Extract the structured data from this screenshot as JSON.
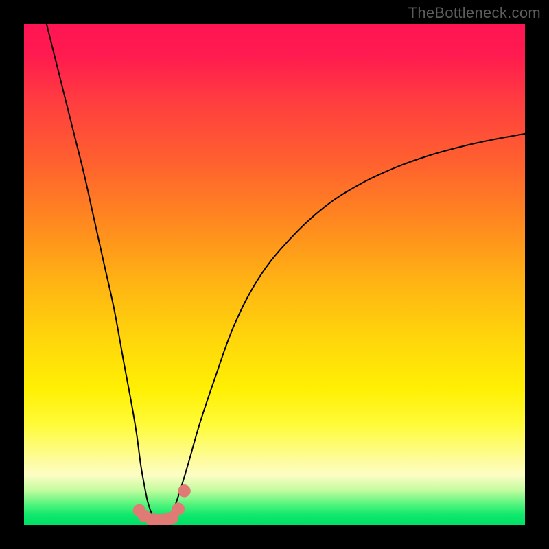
{
  "watermark": "TheBottleneck.com",
  "chart_data": {
    "type": "line",
    "title": "",
    "xlabel": "",
    "ylabel": "",
    "x_range": [
      0,
      100
    ],
    "y_range": [
      0,
      100
    ],
    "series": [
      {
        "name": "left-curve",
        "x": [
          4.5,
          6,
          8,
          10,
          12,
          14,
          16,
          18,
          20,
          21.5,
          22.5,
          23.3,
          24,
          24.6,
          25.2,
          25.8,
          26.4,
          27.0,
          27.5
        ],
        "y": [
          100,
          94,
          86,
          78,
          70,
          61,
          52,
          43,
          32,
          24,
          18,
          12,
          8,
          5,
          3,
          1.7,
          0.8,
          0.3,
          0.0
        ]
      },
      {
        "name": "right-curve",
        "x": [
          27.5,
          28.2,
          29.0,
          30.0,
          31.2,
          33.0,
          35.0,
          38.0,
          42.0,
          47.0,
          53.0,
          60.0,
          67.0,
          74.0,
          81.0,
          88.0,
          94.0,
          100.0
        ],
        "y": [
          0.0,
          0.5,
          1.5,
          3.5,
          7.0,
          13.0,
          20.0,
          29.0,
          40.0,
          49.5,
          57.0,
          63.5,
          68.0,
          71.3,
          73.8,
          75.7,
          77.0,
          78.1
        ]
      }
    ],
    "markers": [
      {
        "name": "valley",
        "x": 23.0,
        "y": 2.9,
        "r": 1.0
      },
      {
        "name": "valley",
        "x": 24.0,
        "y": 1.8,
        "r": 1.0
      },
      {
        "name": "valley",
        "x": 25.8,
        "y": 0.9,
        "r": 1.2
      },
      {
        "name": "valley",
        "x": 27.0,
        "y": 0.8,
        "r": 1.2
      },
      {
        "name": "valley",
        "x": 28.2,
        "y": 0.9,
        "r": 1.2
      },
      {
        "name": "valley",
        "x": 29.6,
        "y": 1.5,
        "r": 1.0
      },
      {
        "name": "valley",
        "x": 30.8,
        "y": 3.2,
        "r": 1.0
      },
      {
        "name": "valley",
        "x": 32.0,
        "y": 6.8,
        "r": 1.0
      }
    ],
    "colors": {
      "curve": "#000000",
      "marker": "#e07a75",
      "gradient_top": "#ff1553",
      "gradient_bottom": "#00e066",
      "frame": "#000000"
    }
  }
}
